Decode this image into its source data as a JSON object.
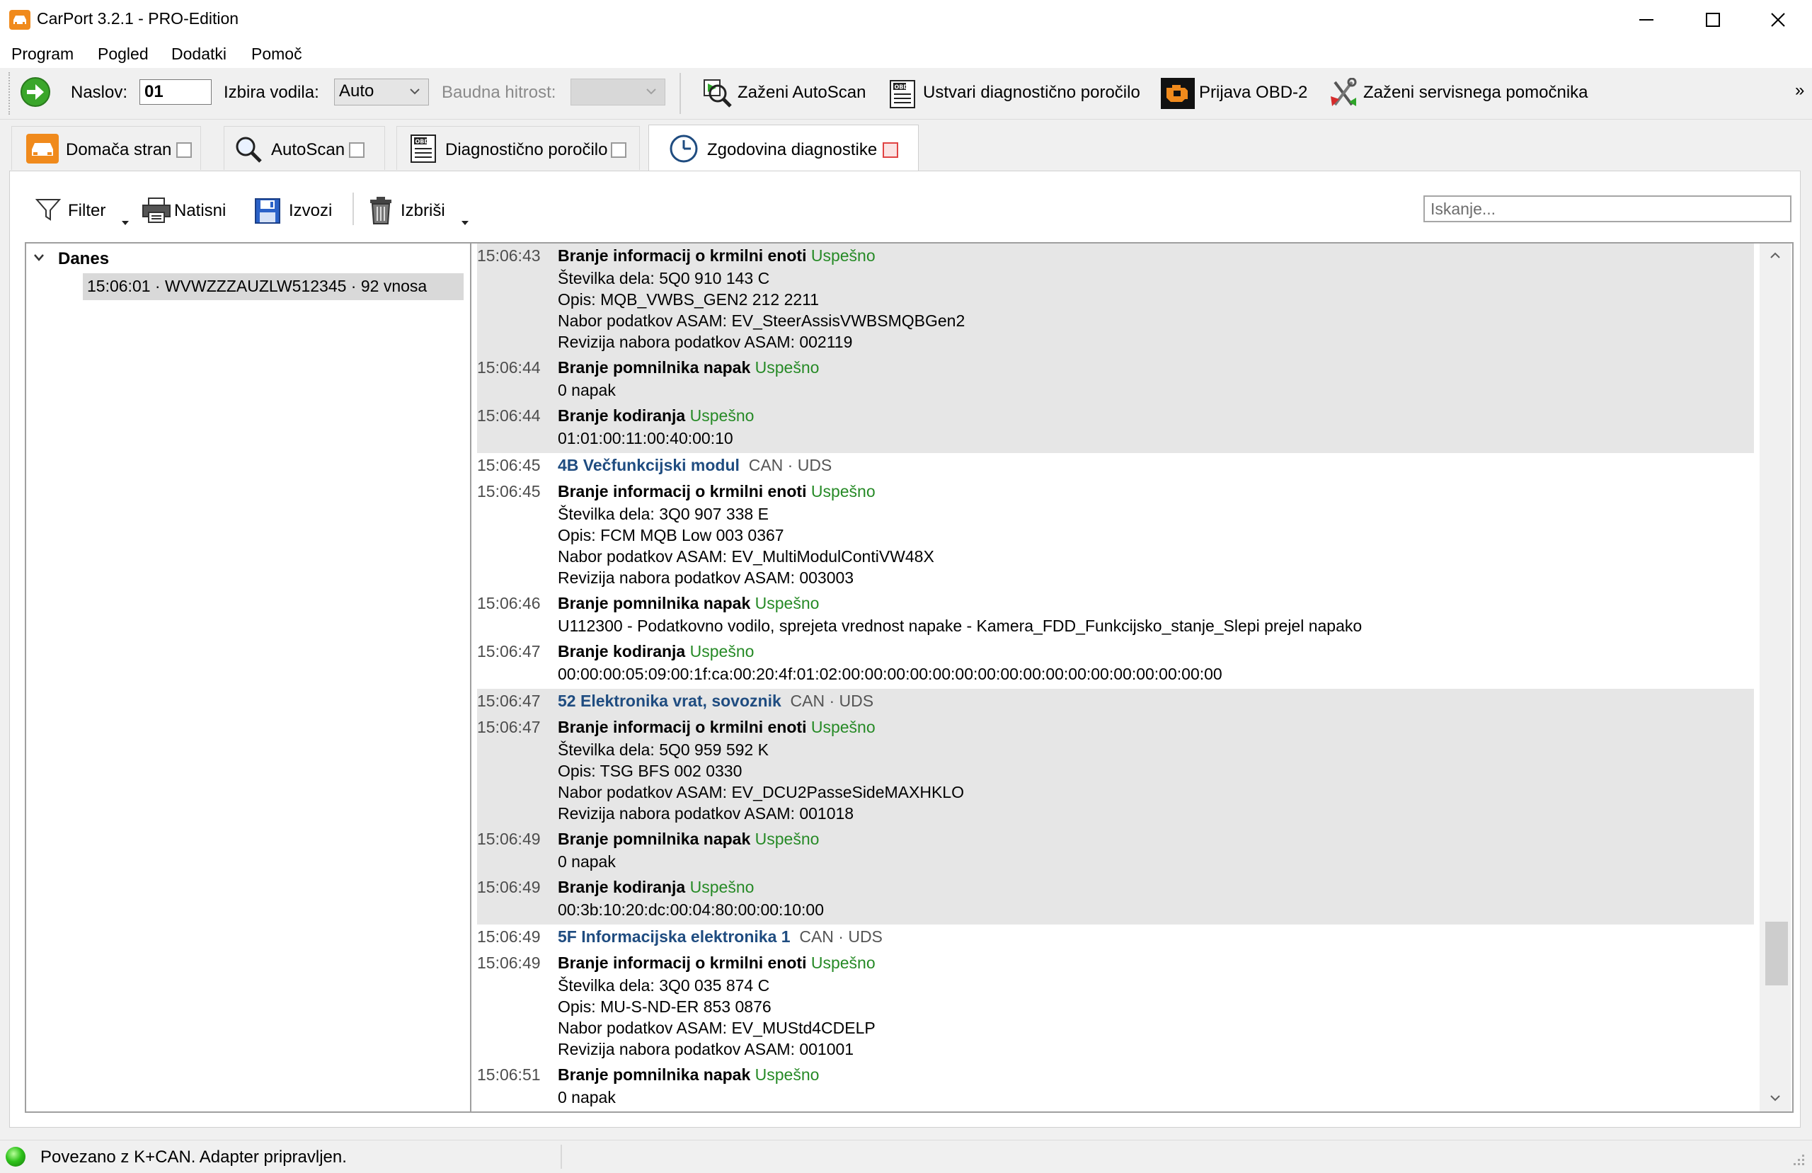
{
  "window": {
    "title": "CarPort 3.2.1 - PRO-Edition",
    "colors": {
      "brand": "#f08a1c",
      "success_text": "#268a26",
      "module_text": "#1f4c80",
      "close_tab_red": "#e04343"
    }
  },
  "menu": [
    "Program",
    "Pogled",
    "Dodatki",
    "Pomoč"
  ],
  "toolbar": {
    "address_label": "Naslov:",
    "address_value": "01",
    "bus_label": "Izbira vodila:",
    "bus_value": "Auto",
    "baud_label": "Baudna hitrost:",
    "baud_value": "",
    "actions": {
      "autoscan": "Zaženi AutoScan",
      "report": "Ustvari diagnostično poročilo",
      "obd": "Prijava OBD-2",
      "service": "Zaženi servisnega pomočnika"
    },
    "overflow": "»"
  },
  "tabs": [
    {
      "label": "Domača stran"
    },
    {
      "label": "AutoScan"
    },
    {
      "label": "Diagnostično poročilo"
    },
    {
      "label": "Zgodovina diagnostike"
    }
  ],
  "content_toolbar": {
    "filter": "Filter",
    "print": "Natisni",
    "export": "Izvozi",
    "delete": "Izbriši",
    "search_placeholder": "Iskanje..."
  },
  "tree": {
    "group": "Danes",
    "item": "15:06:01 · WVWZZZAUZLW512345 · 92 vnosa"
  },
  "log": {
    "groups": [
      {
        "shaded": true,
        "entries": [
          {
            "time": "15:06:43",
            "title": "Branje informacij o krmilni enoti",
            "status": "Uspešno",
            "details": [
              "Številka dela: 5Q0 910 143 C",
              "Opis: MQB_VWBS_GEN2 212 2211",
              "Nabor podatkov ASAM: EV_SteerAssisVWBSMQBGen2",
              "Revizija nabora podatkov ASAM: 002119"
            ]
          },
          {
            "time": "15:06:44",
            "title": "Branje pomnilnika napak",
            "status": "Uspešno",
            "details": [
              "0 napak"
            ]
          },
          {
            "time": "15:06:44",
            "title": "Branje kodiranja",
            "status": "Uspešno",
            "details": [
              "01:01:00:11:00:40:00:10"
            ]
          }
        ]
      },
      {
        "shaded": false,
        "module": {
          "time": "15:06:45",
          "name": "4B Večfunkcijski modul",
          "protocol": "CAN · UDS"
        },
        "entries": [
          {
            "time": "15:06:45",
            "title": "Branje informacij o krmilni enoti",
            "status": "Uspešno",
            "details": [
              "Številka dela: 3Q0 907 338 E",
              "Opis: FCM MQB Low 003 0367",
              "Nabor podatkov ASAM: EV_MultiModulContiVW48X",
              "Revizija nabora podatkov ASAM: 003003"
            ]
          },
          {
            "time": "15:06:46",
            "title": "Branje pomnilnika napak",
            "status": "Uspešno",
            "details": [
              "U112300 - Podatkovno vodilo, sprejeta vrednost napake - Kamera_FDD_Funkcijsko_stanje_Slepi prejel napako"
            ]
          },
          {
            "time": "15:06:47",
            "title": "Branje kodiranja",
            "status": "Uspešno",
            "details": [
              "00:00:00:05:09:00:1f:ca:00:20:4f:01:02:00:00:00:00:00:00:00:00:00:00:00:00:00:00:00:00:00"
            ]
          }
        ]
      },
      {
        "shaded": true,
        "module": {
          "time": "15:06:47",
          "name": "52 Elektronika vrat, sovoznik",
          "protocol": "CAN · UDS"
        },
        "entries": [
          {
            "time": "15:06:47",
            "title": "Branje informacij o krmilni enoti",
            "status": "Uspešno",
            "details": [
              "Številka dela: 5Q0 959 592 K",
              "Opis: TSG BFS 002 0330",
              "Nabor podatkov ASAM: EV_DCU2PasseSideMAXHKLO",
              "Revizija nabora podatkov ASAM: 001018"
            ]
          },
          {
            "time": "15:06:49",
            "title": "Branje pomnilnika napak",
            "status": "Uspešno",
            "details": [
              "0 napak"
            ]
          },
          {
            "time": "15:06:49",
            "title": "Branje kodiranja",
            "status": "Uspešno",
            "details": [
              "00:3b:10:20:dc:00:04:80:00:00:10:00"
            ]
          }
        ]
      },
      {
        "shaded": false,
        "module": {
          "time": "15:06:49",
          "name": "5F Informacijska elektronika 1",
          "protocol": "CAN · UDS"
        },
        "entries": [
          {
            "time": "15:06:49",
            "title": "Branje informacij o krmilni enoti",
            "status": "Uspešno",
            "details": [
              "Številka dela: 3Q0 035 874 C",
              "Opis: MU-S-ND-ER 853 0876",
              "Nabor podatkov ASAM: EV_MUStd4CDELP",
              "Revizija nabora podatkov ASAM: 001001"
            ]
          },
          {
            "time": "15:06:51",
            "title": "Branje pomnilnika napak",
            "status": "Uspešno",
            "details": [
              "0 napak"
            ]
          }
        ]
      }
    ]
  },
  "status": {
    "text": "Povezano z K+CAN. Adapter pripravljen.",
    "indicator_color": "#2fc21b"
  }
}
